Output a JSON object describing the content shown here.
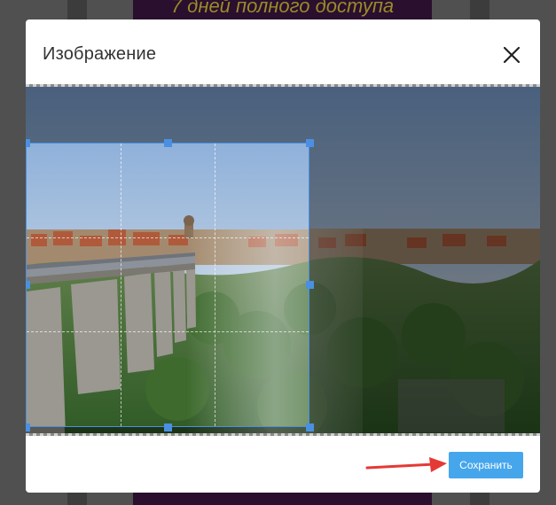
{
  "background": {
    "banner_text": "7 дней полного доступа"
  },
  "modal": {
    "title": "Изображение",
    "save_label": "Сохранить"
  },
  "icons": {
    "close": "close-icon",
    "annotation": "red-arrow-annotation"
  },
  "colors": {
    "accent": "#45a6ec",
    "crop_border": "#4a90e2",
    "annotation_arrow": "#e53935"
  }
}
